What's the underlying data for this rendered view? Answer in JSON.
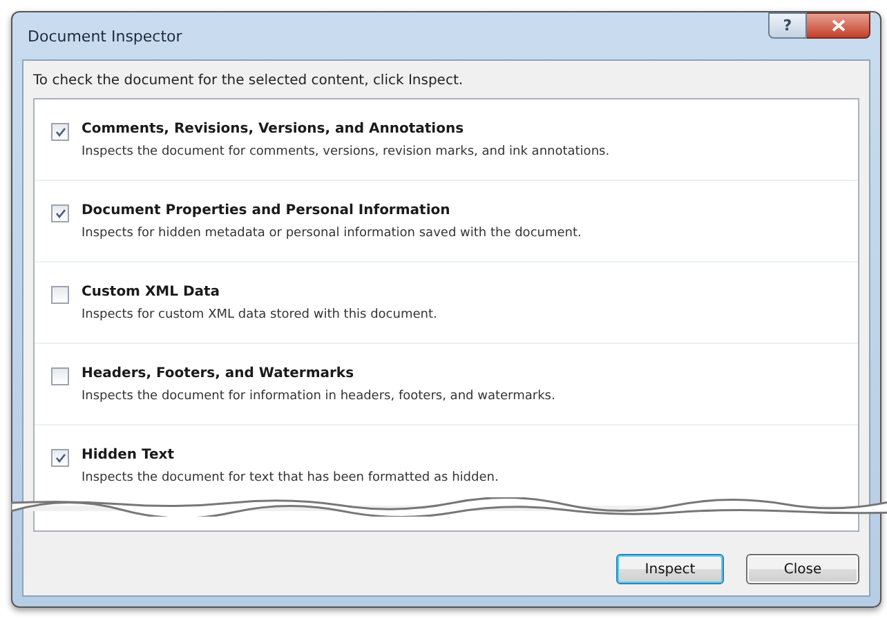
{
  "window": {
    "title": "Document Inspector",
    "help_button": "?"
  },
  "instruction": "To check the document for the selected content, click Inspect.",
  "items": [
    {
      "label": "Comments, Revisions, Versions, and Annotations",
      "description": "Inspects the document for comments, versions, revision marks, and ink annotations.",
      "checked": true
    },
    {
      "label": "Document Properties and Personal Information",
      "description": "Inspects for hidden metadata or personal information saved with the document.",
      "checked": true
    },
    {
      "label": "Custom XML Data",
      "description": "Inspects for custom XML data stored with this document.",
      "checked": false
    },
    {
      "label": "Headers, Footers, and Watermarks",
      "description": "Inspects the document for information in headers, footers, and watermarks.",
      "checked": false
    },
    {
      "label": "Hidden Text",
      "description": "Inspects the document for text that has been formatted as hidden.",
      "checked": true
    }
  ],
  "buttons": [
    "Inspect",
    "Close"
  ]
}
